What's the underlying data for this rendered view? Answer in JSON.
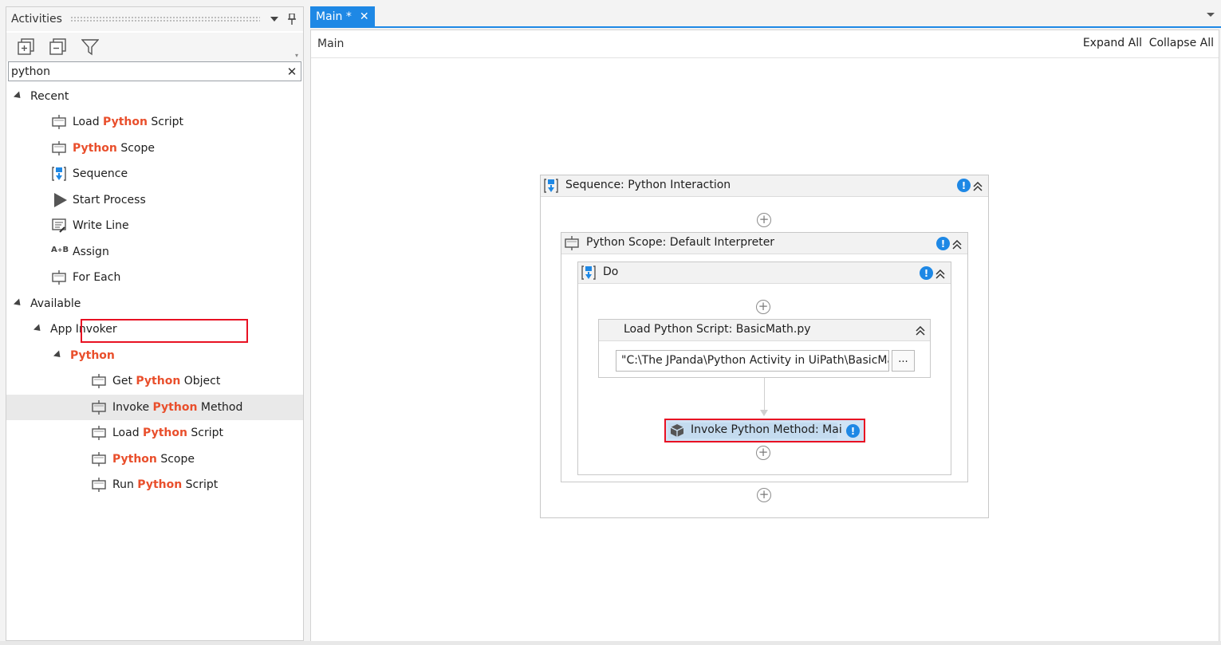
{
  "activities_panel": {
    "title": "Activities",
    "search": {
      "value": "python",
      "placeholder": ""
    },
    "tree": [
      {
        "text_before": "Recent",
        "keyword": "",
        "text_after": "",
        "icon": "caret-expanded"
      },
      {
        "text_before": "Load ",
        "keyword": "Python",
        "text_after": " Script",
        "icon": "activity-icon"
      },
      {
        "text_before": "",
        "keyword": "Python",
        "text_after": " Scope",
        "icon": "activity-icon"
      },
      {
        "text_before": "Sequence",
        "keyword": "",
        "text_after": "",
        "icon": "sequence-icon"
      },
      {
        "text_before": "Start Process",
        "keyword": "",
        "text_after": "",
        "icon": "play-icon"
      },
      {
        "text_before": "Write Line",
        "keyword": "",
        "text_after": "",
        "icon": "write-line-icon"
      },
      {
        "text_before": "Assign",
        "keyword": "",
        "text_after": "",
        "icon": "assign-icon"
      },
      {
        "text_before": "For Each",
        "keyword": "",
        "text_after": "",
        "icon": "activity-icon"
      },
      {
        "text_before": "Available",
        "keyword": "",
        "text_after": "",
        "icon": "caret-expanded"
      },
      {
        "text_before": "App Invoker",
        "keyword": "",
        "text_after": "",
        "icon": "caret-expanded"
      },
      {
        "text_before": "",
        "keyword": "Python",
        "text_after": "",
        "icon": "caret-expanded"
      },
      {
        "text_before": "Get ",
        "keyword": "Python",
        "text_after": " Object",
        "icon": "activity-icon"
      },
      {
        "text_before": "Invoke ",
        "keyword": "Python",
        "text_after": " Method",
        "icon": "activity-icon"
      },
      {
        "text_before": "Load ",
        "keyword": "Python",
        "text_after": " Script",
        "icon": "activity-icon"
      },
      {
        "text_before": "",
        "keyword": "Python",
        "text_after": " Scope",
        "icon": "activity-icon"
      },
      {
        "text_before": "Run ",
        "keyword": "Python",
        "text_after": " Script",
        "icon": "activity-icon"
      }
    ]
  },
  "tabs": [
    {
      "label": "Main *",
      "close": "✕"
    }
  ],
  "designer": {
    "breadcrumb": "Main",
    "expand_all": "Expand All",
    "collapse_all": "Collapse All",
    "sequence_title": "Sequence: Python Interaction",
    "scope_title": "Python Scope: Default Interpreter",
    "do_title": "Do",
    "load_script_title": "Load Python Script: BasicMath.py",
    "load_script_path": "\"C:\\The JPanda\\Python Activity in UiPath\\BasicMat",
    "browse_label": "...",
    "invoke_title": "Invoke Python Method: Mai",
    "warning_glyph": "!"
  },
  "colors": {
    "accent": "#1e88e5",
    "keyword_highlight": "#e94f2c",
    "highlight_border": "#e81123",
    "selected_activity_bg": "#cfe3f5"
  }
}
